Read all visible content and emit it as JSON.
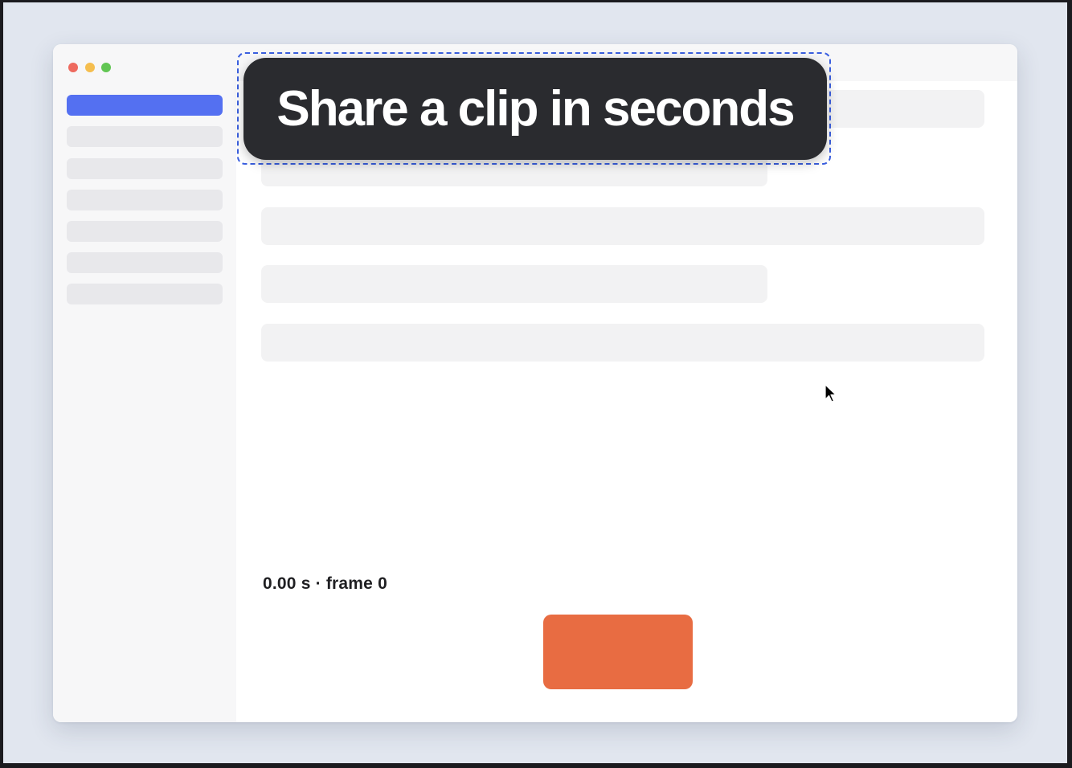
{
  "app": {
    "accent_color": "#5470f1",
    "record_color": "#e86c42"
  },
  "window": {
    "controls": [
      "close",
      "minimize",
      "zoom"
    ]
  },
  "sidebar": {
    "items": [
      {
        "state": "active"
      },
      {
        "state": "placeholder"
      },
      {
        "state": "placeholder"
      },
      {
        "state": "placeholder"
      },
      {
        "state": "placeholder"
      },
      {
        "state": "placeholder"
      },
      {
        "state": "placeholder"
      }
    ]
  },
  "content": {
    "timecode": "0.00 s · frame 0"
  },
  "callout": {
    "text": "Share a clip in seconds"
  },
  "cursor": {
    "icon": "arrow-pointer-icon"
  }
}
